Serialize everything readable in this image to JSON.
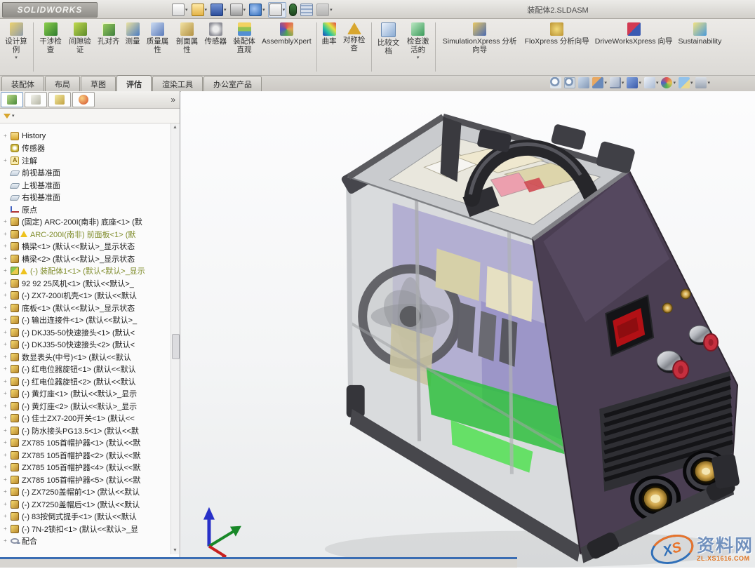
{
  "titlebar": {
    "app": "SOLIDWORKS",
    "document": "装配体2.SLDASM",
    "quick_tools": [
      {
        "name": "new-document-icon",
        "dd": true
      },
      {
        "name": "open-icon",
        "dd": true
      },
      {
        "name": "save-icon",
        "dd": true
      },
      {
        "name": "print-icon",
        "dd": true
      },
      {
        "name": "undo-icon",
        "dd": true
      },
      {
        "name": "select-icon",
        "dd": true,
        "pressed": "pressed"
      },
      {
        "name": "rebuild-icon"
      },
      {
        "name": "file-properties-icon"
      },
      {
        "name": "options-icon",
        "dd": true
      }
    ]
  },
  "glyphs": {
    "dropdown": "▾",
    "flyout": "»",
    "scroll_up": "▲",
    "scroll_down": "▼",
    "expander": "+"
  },
  "ribbon": {
    "items": [
      {
        "type": "tool",
        "label": "设计算例",
        "icon": "design-study-icon",
        "dd": true
      },
      {
        "type": "sep"
      },
      {
        "type": "tool",
        "label": "干涉检查",
        "icon": "interference-check-icon"
      },
      {
        "type": "tool",
        "label": "间隙验证",
        "icon": "clearance-verify-icon"
      },
      {
        "type": "tool",
        "label": "孔对齐",
        "icon": "hole-alignment-icon"
      },
      {
        "type": "tool",
        "label": "测量",
        "icon": "measure-icon"
      },
      {
        "type": "tool",
        "label": "质量属性",
        "icon": "mass-properties-icon"
      },
      {
        "type": "tool",
        "label": "剖面属性",
        "icon": "section-properties-icon"
      },
      {
        "type": "tool",
        "label": "传感器",
        "icon": "sensor-icon"
      },
      {
        "type": "tool",
        "label": "装配体直观",
        "icon": "assembly-visualization-icon"
      },
      {
        "type": "tool",
        "label": "AssemblyXpert",
        "icon": "assemblyxpert-icon",
        "wide": "wide"
      },
      {
        "type": "sep"
      },
      {
        "type": "tool",
        "label": "曲率",
        "icon": "curvature-icon"
      },
      {
        "type": "tool",
        "label": "对称检查",
        "icon": "symmetry-check-icon"
      },
      {
        "type": "sep"
      },
      {
        "type": "tool",
        "label": "比较文档",
        "icon": "compare-documents-icon"
      },
      {
        "type": "tool",
        "label": "检查激活的",
        "icon": "check-active-icon",
        "dd": true
      },
      {
        "type": "sep"
      },
      {
        "type": "tool",
        "label": "SimulationXpress 分析向导",
        "icon": "simulationxpress-icon",
        "wide": "wide"
      },
      {
        "type": "tool",
        "label": "FloXpress 分析向导",
        "icon": "floxpress-icon",
        "wide": "wide"
      },
      {
        "type": "tool",
        "label": "DriveWorksXpress 向导",
        "icon": "driveworksxpress-icon",
        "wide": "wide"
      },
      {
        "type": "tool",
        "label": "Sustainability",
        "icon": "sustainability-icon",
        "wide": "wide"
      }
    ]
  },
  "tabs": [
    {
      "label": "装配体"
    },
    {
      "label": "布局"
    },
    {
      "label": "草图"
    },
    {
      "label": "评估",
      "active": "active"
    },
    {
      "label": "渲染工具"
    },
    {
      "label": "办公室产品"
    }
  ],
  "hud": [
    {
      "name": "zoom-fit-icon"
    },
    {
      "name": "zoom-area-icon"
    },
    {
      "name": "previous-view-icon"
    },
    {
      "name": "section-view-icon",
      "dd": true
    },
    {
      "name": "view-orientation-icon",
      "dd": true
    },
    {
      "name": "display-style-icon",
      "dd": true
    },
    {
      "name": "hide-show-items-icon",
      "dd": true
    },
    {
      "name": "edit-appearance-icon",
      "dd": true
    },
    {
      "name": "apply-scene-icon",
      "dd": true
    },
    {
      "name": "view-settings-icon",
      "dd": true
    }
  ],
  "sidebar": {
    "panel_tabs": [
      {
        "name": "featuremanager-tab-icon",
        "active": "active"
      },
      {
        "name": "propertymanager-tab-icon"
      },
      {
        "name": "configurationmanager-tab-icon"
      },
      {
        "name": "appearances-tab-icon"
      }
    ],
    "tree": [
      {
        "icon": "folder-history-icon",
        "label": "History",
        "exp": true
      },
      {
        "icon": "sensors-icon",
        "label": "传感器"
      },
      {
        "icon": "annotations-icon",
        "label": "注解",
        "exp": true
      },
      {
        "icon": "plane-icon",
        "label": "前视基准面"
      },
      {
        "icon": "plane-icon",
        "label": "上视基准面"
      },
      {
        "icon": "plane-icon",
        "label": "右视基准面"
      },
      {
        "icon": "origin-icon",
        "label": "原点"
      },
      {
        "icon": "part-icon",
        "label": "(固定) ARC-200I(南非) 底座<1> (默",
        "exp": true
      },
      {
        "icon": "part-icon",
        "label": "ARC-200I(南非) 前面板<1> (默",
        "cls": "olive",
        "warn": true,
        "exp": true
      },
      {
        "icon": "part-icon",
        "label": "横梁<1> (默认<<默认>_显示状态",
        "exp": true
      },
      {
        "icon": "part-icon",
        "label": "横梁<2> (默认<<默认>_显示状态",
        "exp": true
      },
      {
        "icon": "subassembly-icon",
        "label": "(-) 装配体1<1> (默认<默认>_显示",
        "cls": "olive",
        "warn": true,
        "exp": true
      },
      {
        "icon": "part-icon",
        "label": "92 92 25风机<1> (默认<<默认>_",
        "exp": true
      },
      {
        "icon": "part-icon",
        "label": "(-) ZX7-200I机壳<1> (默认<<默认",
        "exp": true
      },
      {
        "icon": "part-icon",
        "label": "底板<1> (默认<<默认>_显示状态",
        "exp": true
      },
      {
        "icon": "part-icon",
        "label": "(-) 输出连接件<1> (默认<<默认>_",
        "exp": true
      },
      {
        "icon": "part-icon",
        "label": "(-) DKJ35-50快速接头<1> (默认<",
        "exp": true
      },
      {
        "icon": "part-icon",
        "label": "(-) DKJ35-50快速接头<2> (默认<",
        "exp": true
      },
      {
        "icon": "part-icon",
        "label": "数显表头(中号)<1> (默认<<默认",
        "exp": true
      },
      {
        "icon": "part-icon",
        "label": "(-) 红电位器旋钮<1> (默认<<默认",
        "exp": true
      },
      {
        "icon": "part-icon",
        "label": "(-) 红电位器旋钮<2> (默认<<默认",
        "exp": true
      },
      {
        "icon": "part-icon",
        "label": "(-) 黄灯座<1> (默认<<默认>_显示",
        "exp": true
      },
      {
        "icon": "part-icon",
        "label": "(-) 黄灯座<2> (默认<<默认>_显示",
        "exp": true
      },
      {
        "icon": "part-icon",
        "label": "(-) 佳士ZX7-200开关<1> (默认<<",
        "exp": true
      },
      {
        "icon": "part-icon",
        "label": "(-) 防水接头PG13.5<1> (默认<<默",
        "exp": true
      },
      {
        "icon": "part-icon",
        "label": "ZX785 105首帽护器<1> (默认<<默",
        "exp": true
      },
      {
        "icon": "part-icon",
        "label": "ZX785 105首帽护器<2> (默认<<默",
        "exp": true
      },
      {
        "icon": "part-icon",
        "label": "ZX785 105首帽护器<4> (默认<<默",
        "exp": true
      },
      {
        "icon": "part-icon",
        "label": "ZX785 105首帽护器<5> (默认<<默",
        "exp": true
      },
      {
        "icon": "part-icon",
        "label": "(-) ZX7250盖帽前<1> (默认<<默认",
        "exp": true
      },
      {
        "icon": "part-icon",
        "label": "(-) ZX7250盖帽后<1> (默认<<默认",
        "exp": true
      },
      {
        "icon": "part-icon",
        "label": "(-) 83按倒式提手<1> (默认<<默认",
        "exp": true
      },
      {
        "icon": "part-icon",
        "label": "(-) 7N-2锁扣<1> (默认<<默认>_显",
        "exp": true
      },
      {
        "icon": "mates-icon",
        "label": "配合",
        "exp": true
      }
    ]
  },
  "viewport": {
    "watermark": {
      "logo_x": "X",
      "logo_s": "S",
      "site": "资料网",
      "url": "ZL.XS1616.COM"
    }
  }
}
